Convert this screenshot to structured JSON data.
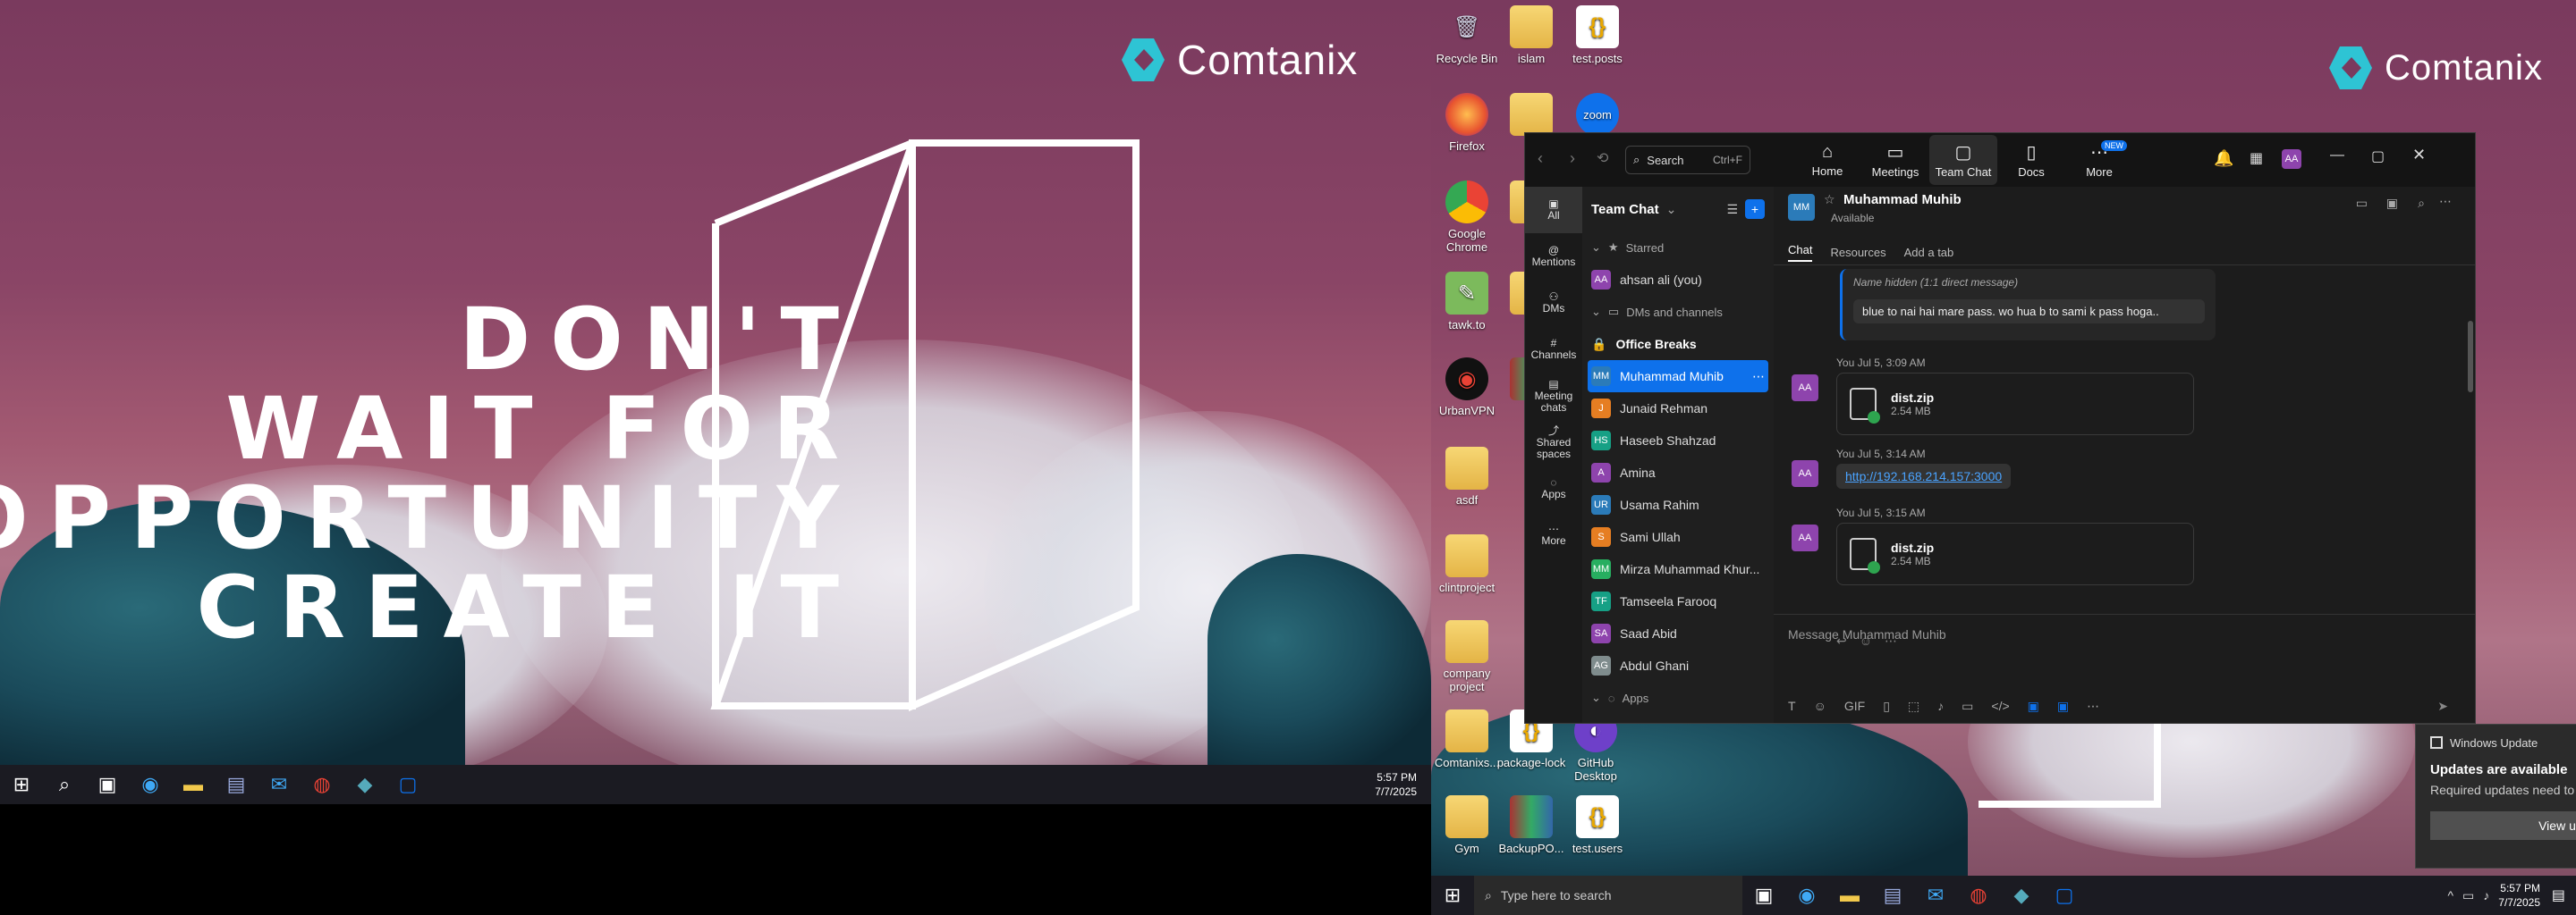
{
  "left_screen": {
    "logo_text": "Comtanix",
    "quote_lines": [
      "DON'T",
      "WAIT FOR",
      "OPPORTUNITY",
      "CREATE IT"
    ],
    "taskbar": {
      "clock_time": "5:57 PM",
      "clock_date": "7/7/2025"
    }
  },
  "right_screen": {
    "logo_text": "Comtanix",
    "desktop_icons": [
      {
        "label": "Recycle Bin",
        "type": "recycle"
      },
      {
        "label": "islam",
        "type": "folder"
      },
      {
        "label": "test.posts",
        "type": "json"
      },
      {
        "label": "Firefox",
        "type": "firefox"
      },
      {
        "label": "zoom",
        "type": "zoom"
      },
      {
        "label": "Google Chrome",
        "type": "chrome"
      },
      {
        "label": "tawk.to",
        "type": "app"
      },
      {
        "label": "UrbanVPN",
        "type": "app"
      },
      {
        "label": "asdf",
        "type": "folder"
      },
      {
        "label": "clintproject",
        "type": "folder"
      },
      {
        "label": "company project",
        "type": "folder"
      },
      {
        "label": "Comtanixs...",
        "type": "folder"
      },
      {
        "label": "package-lock",
        "type": "file"
      },
      {
        "label": "GitHub Desktop",
        "type": "app"
      },
      {
        "label": "Gym",
        "type": "folder"
      },
      {
        "label": "BackupPO...",
        "type": "archive"
      },
      {
        "label": "test.users",
        "type": "json"
      }
    ],
    "taskbar": {
      "search_placeholder": "Type here to search",
      "clock_time": "5:57 PM",
      "clock_date": "7/7/2025"
    },
    "toast": {
      "source": "Windows Update",
      "title": "Updates are available",
      "body": "Required updates need to be downloaded.",
      "button": "View updates"
    }
  },
  "zoom": {
    "search_label": "Search",
    "search_shortcut": "Ctrl+F",
    "nav": [
      {
        "label": "Home",
        "icon": "home-icon"
      },
      {
        "label": "Meetings",
        "icon": "video-icon"
      },
      {
        "label": "Team Chat",
        "icon": "chat-icon"
      },
      {
        "label": "Docs",
        "icon": "doc-icon"
      },
      {
        "label": "More",
        "icon": "more-icon",
        "badge": "NEW"
      }
    ],
    "profile_initials": "AA",
    "rail": [
      {
        "label": "All"
      },
      {
        "label": "Mentions"
      },
      {
        "label": "DMs"
      },
      {
        "label": "Channels"
      },
      {
        "label": "Meeting chats"
      },
      {
        "label": "Shared spaces"
      },
      {
        "label": "Apps"
      },
      {
        "label": "More"
      }
    ],
    "sidebar": {
      "title": "Team Chat",
      "starred_label": "Starred",
      "starred": [
        {
          "initials": "AA",
          "name": "ahsan ali (you)",
          "color": "#8e44ad"
        }
      ],
      "dms_label": "DMs and channels",
      "channel": "Office Breaks",
      "contacts": [
        {
          "initials": "MM",
          "name": "Muhammad Muhib",
          "color": "#2b7bb9",
          "active": true
        },
        {
          "initials": "J",
          "name": "Junaid Rehman",
          "color": "#e67e22"
        },
        {
          "initials": "HS",
          "name": "Haseeb Shahzad",
          "color": "#16a085"
        },
        {
          "initials": "A",
          "name": "Amina",
          "color": "#8e44ad"
        },
        {
          "initials": "UR",
          "name": "Usama Rahim",
          "color": "#2b7bb9"
        },
        {
          "initials": "S",
          "name": "Sami Ullah",
          "color": "#e67e22"
        },
        {
          "initials": "MM",
          "name": "Mirza Muhammad Khur...",
          "color": "#27ae60"
        },
        {
          "initials": "TF",
          "name": "Tamseela Farooq",
          "color": "#16a085"
        },
        {
          "initials": "SA",
          "name": "Saad Abid",
          "color": "#8e44ad"
        },
        {
          "initials": "AG",
          "name": "Abdul Ghani",
          "color": "#7f8c8d"
        }
      ],
      "apps_label": "Apps"
    },
    "chat": {
      "contact_initials": "MM",
      "contact_name": "Muhammad Muhib",
      "status": "Available",
      "tabs": [
        "Chat",
        "Resources",
        "Add a tab"
      ],
      "quoted_sender": "Name hidden (1:1 direct message)",
      "quoted_text": "blue to nai hai mare pass. wo hua b to sami k pass hoga..",
      "messages": [
        {
          "meta": "You Jul 5, 3:09 AM",
          "kind": "file",
          "file_name": "dist.zip",
          "file_size": "2.54 MB"
        },
        {
          "meta": "You Jul 5, 3:14 AM",
          "kind": "link",
          "link": "http://192.168.214.157:3000"
        },
        {
          "meta": "You Jul 5, 3:15 AM",
          "kind": "file",
          "file_name": "dist.zip",
          "file_size": "2.54 MB"
        }
      ],
      "composer_placeholder": "Message Muhammad Muhib"
    }
  }
}
